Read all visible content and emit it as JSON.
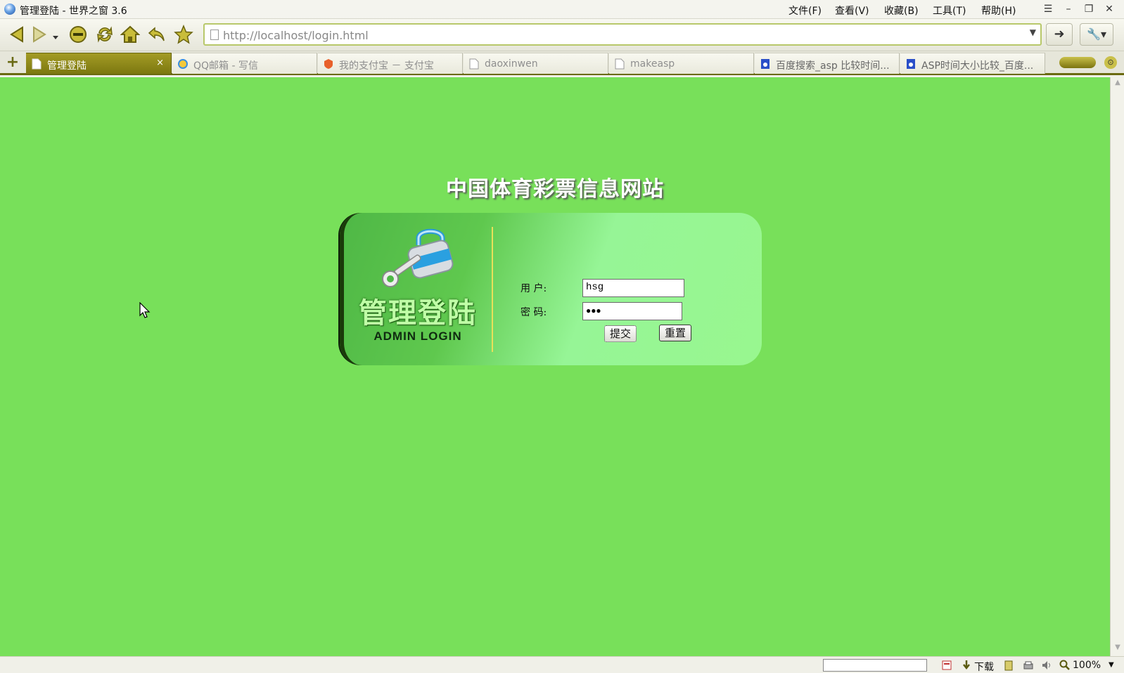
{
  "window": {
    "title": "管理登陆 - 世界之窗 3.6",
    "menu": [
      "文件(F)",
      "查看(V)",
      "收藏(B)",
      "工具(T)",
      "帮助(H)"
    ],
    "controls": {
      "options": "☰",
      "minimize": "–",
      "restore": "❐",
      "close": "✕"
    }
  },
  "toolbar": {
    "url": "http://localhost/login.html",
    "go_label": "➜",
    "tools_label": "🔧▾",
    "icons": [
      "back-icon",
      "forward-icon",
      "stop-icon",
      "refresh-icon",
      "home-icon",
      "undo-icon",
      "favorites-icon"
    ]
  },
  "tabs": {
    "new_tab_label": "+",
    "items": [
      {
        "label": "管理登陆",
        "active": true,
        "icon": "page-icon"
      },
      {
        "label": "QQ邮箱 - 写信",
        "active": false,
        "icon": "qq-icon"
      },
      {
        "label": "我的支付宝 － 支付宝",
        "active": false,
        "icon": "alipay-icon"
      },
      {
        "label": "daoxinwen",
        "active": false,
        "icon": "page-icon"
      },
      {
        "label": "makeasp",
        "active": false,
        "icon": "page-icon"
      },
      {
        "label": "百度搜索_asp 比较时间...",
        "active": false,
        "icon": "baidu-icon"
      },
      {
        "label": "ASP时间大小比较_百度...",
        "active": false,
        "icon": "baidu-icon"
      }
    ],
    "close_label": "×"
  },
  "page": {
    "site_title": "中国体育彩票信息网站",
    "admin_title": "管理登陆",
    "admin_subtitle": "ADMIN LOGIN",
    "form": {
      "user_label": "用  户:",
      "user_value": "hsg",
      "password_label": "密  码:",
      "password_value": "●●●",
      "submit_label": "提交",
      "reset_label": "重置"
    }
  },
  "statusbar": {
    "download_label": "下载",
    "zoom": "100%"
  },
  "colors": {
    "page_background": "#78e05a",
    "panel_dark": "#1a3a0a",
    "tab_active": "#8e8a18"
  }
}
